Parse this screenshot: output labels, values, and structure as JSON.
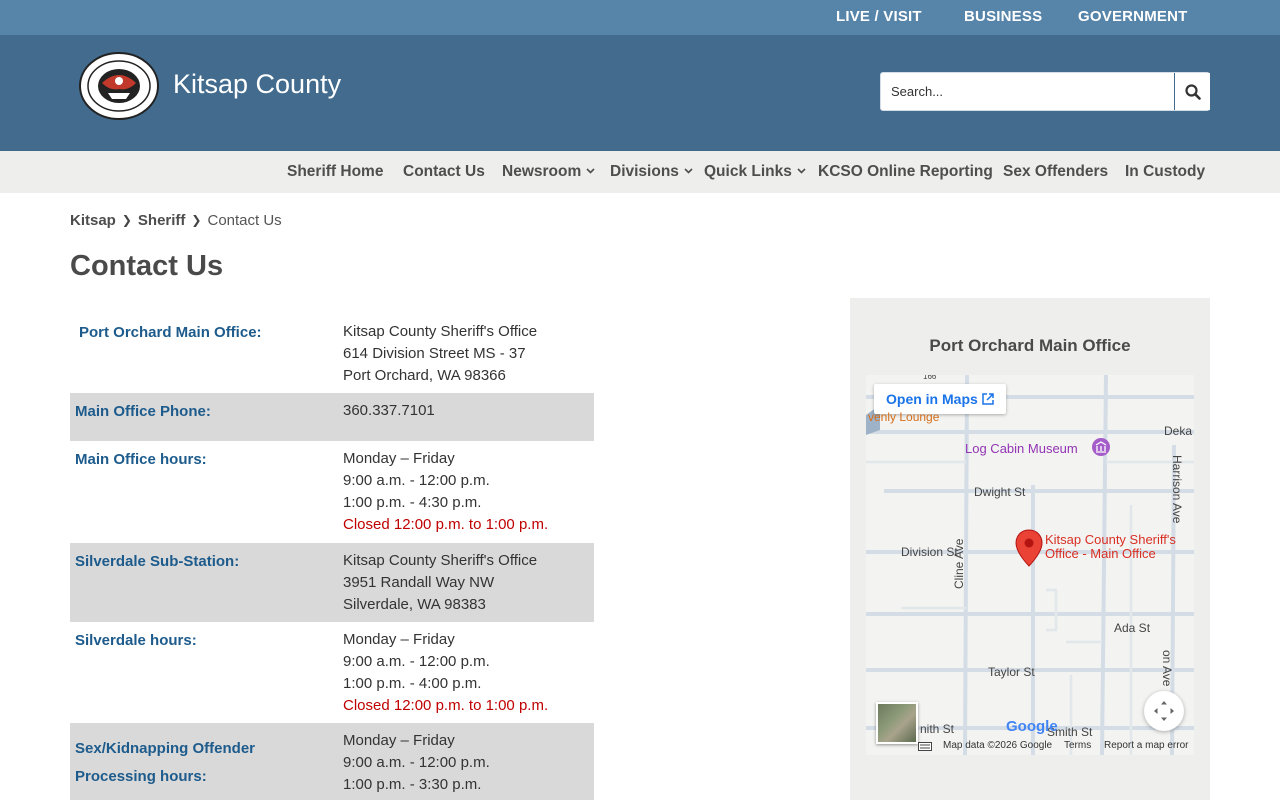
{
  "utility_nav": [
    "LIVE / VISIT",
    "BUSINESS",
    "GOVERNMENT"
  ],
  "header": {
    "site_title": "Kitsap County",
    "seal_text": [
      "KITSAP COUNTY",
      "WASHINGTON",
      "18",
      "57"
    ],
    "search_placeholder": "Search..."
  },
  "subnav": [
    {
      "label": "Sheriff Home",
      "dropdown": false
    },
    {
      "label": "Contact Us",
      "dropdown": false
    },
    {
      "label": "Newsroom",
      "dropdown": true
    },
    {
      "label": "Divisions",
      "dropdown": true
    },
    {
      "label": "Quick Links",
      "dropdown": true
    },
    {
      "label": "KCSO Online Reporting",
      "dropdown": false
    },
    {
      "label": "Sex Offenders",
      "dropdown": false
    },
    {
      "label": "In Custody",
      "dropdown": false
    }
  ],
  "breadcrumb": [
    "Kitsap",
    "Sheriff",
    "Contact Us"
  ],
  "page_title": "Contact Us",
  "contact_rows": [
    {
      "label": [
        "Port Orchard Main Office:"
      ],
      "lines": [
        "Kitsap County Sheriff's Office",
        "614 Division Street  MS - 37",
        "Port Orchard, WA 98366"
      ],
      "closed": ""
    },
    {
      "label": [
        "Main Office Phone:"
      ],
      "lines": [
        "360.337.7101"
      ],
      "closed": ""
    },
    {
      "label": [
        "Main Office hours:"
      ],
      "lines": [
        "Monday – Friday",
        "9:00 a.m. - 12:00 p.m.",
        "1:00 p.m. - 4:30 p.m."
      ],
      "closed": "Closed 12:00 p.m. to 1:00 p.m."
    },
    {
      "label": [
        "Silverdale Sub-Station:"
      ],
      "lines": [
        "Kitsap County Sheriff's Office",
        "3951 Randall Way NW",
        "Silverdale, WA 98383"
      ],
      "closed": ""
    },
    {
      "label": [
        "Silverdale hours:"
      ],
      "lines": [
        "Monday – Friday",
        "9:00 a.m. - 12:00 p.m.",
        "1:00 p.m. - 4:00 p.m."
      ],
      "closed": "Closed 12:00 p.m. to 1:00 p.m."
    },
    {
      "label": [
        "Sex/Kidnapping Offender",
        "Processing hours:"
      ],
      "lines": [
        "Monday – Friday",
        "9:00 a.m. - 12:00 p.m.",
        "1:00 p.m. - 3:30 p.m."
      ],
      "closed": ""
    }
  ],
  "map_card": {
    "title": "Port Orchard Main Office",
    "open_in_maps": "Open in Maps",
    "marker_label": [
      "Kitsap County Sheriff's",
      "Office - Main Office"
    ],
    "streets": [
      "Dwight St",
      "Division St",
      "Cline Ave",
      "Harrison Ave",
      "Ada St",
      "Taylor St",
      "Smith St",
      "Deka",
      "nith St",
      "Au",
      "on Ave",
      "166"
    ],
    "poi": [
      "Log Cabin Museum",
      "venly Lounge"
    ],
    "footer": {
      "map_data": "Map data ©2026 Google",
      "terms": "Terms",
      "report": "Report a map error"
    },
    "google_logo": "Google"
  }
}
